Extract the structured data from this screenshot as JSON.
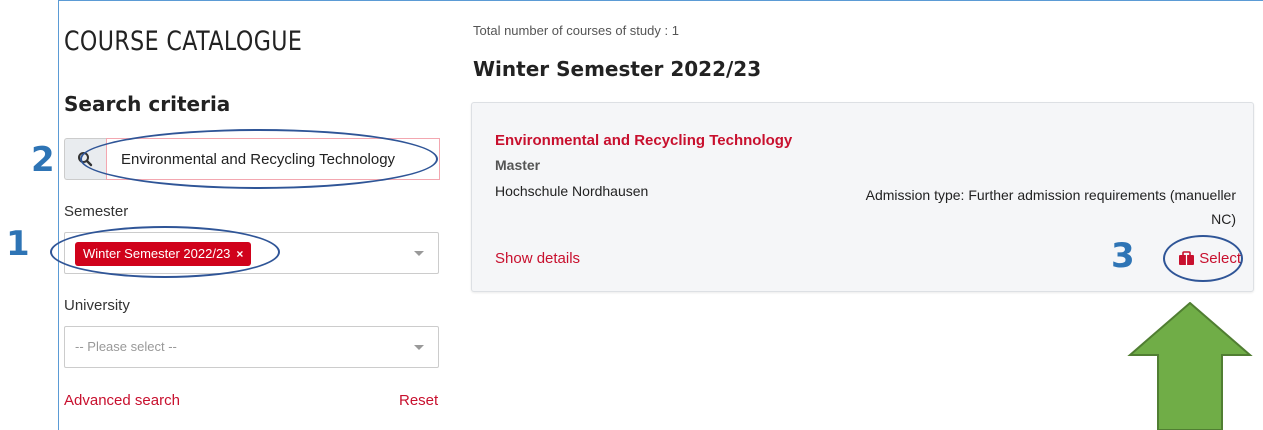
{
  "sidebar": {
    "catalog_title": "COURSE CATALOGUE",
    "search_heading": "Search criteria",
    "search": {
      "value": "Environmental and Recycling Technology"
    },
    "semester": {
      "label": "Semester",
      "chip": "Winter Semester 2022/23",
      "chip_remove": "×"
    },
    "university": {
      "label": "University",
      "placeholder": "-- Please select --"
    },
    "advanced_search": "Advanced search",
    "reset": "Reset"
  },
  "main": {
    "total": "Total number of courses of study : 1",
    "semester_heading": "Winter Semester 2022/23",
    "course": {
      "name": "Environmental and Recycling Technology",
      "degree": "Master",
      "university": "Hochschule Nordhausen",
      "admission": "Admission type: Further admission requirements (manueller NC)",
      "show_details": "Show details",
      "select": "Select"
    }
  },
  "annotations": {
    "one": "1",
    "two": "2",
    "three": "3"
  },
  "colors": {
    "accent": "#c8102e",
    "chip": "#d0021b",
    "annotation": "#2e74b5",
    "arrow": "#70ad47"
  },
  "icons": [
    "search-icon",
    "chevron-down-icon",
    "cart-icon",
    "arrow-up-icon"
  ]
}
